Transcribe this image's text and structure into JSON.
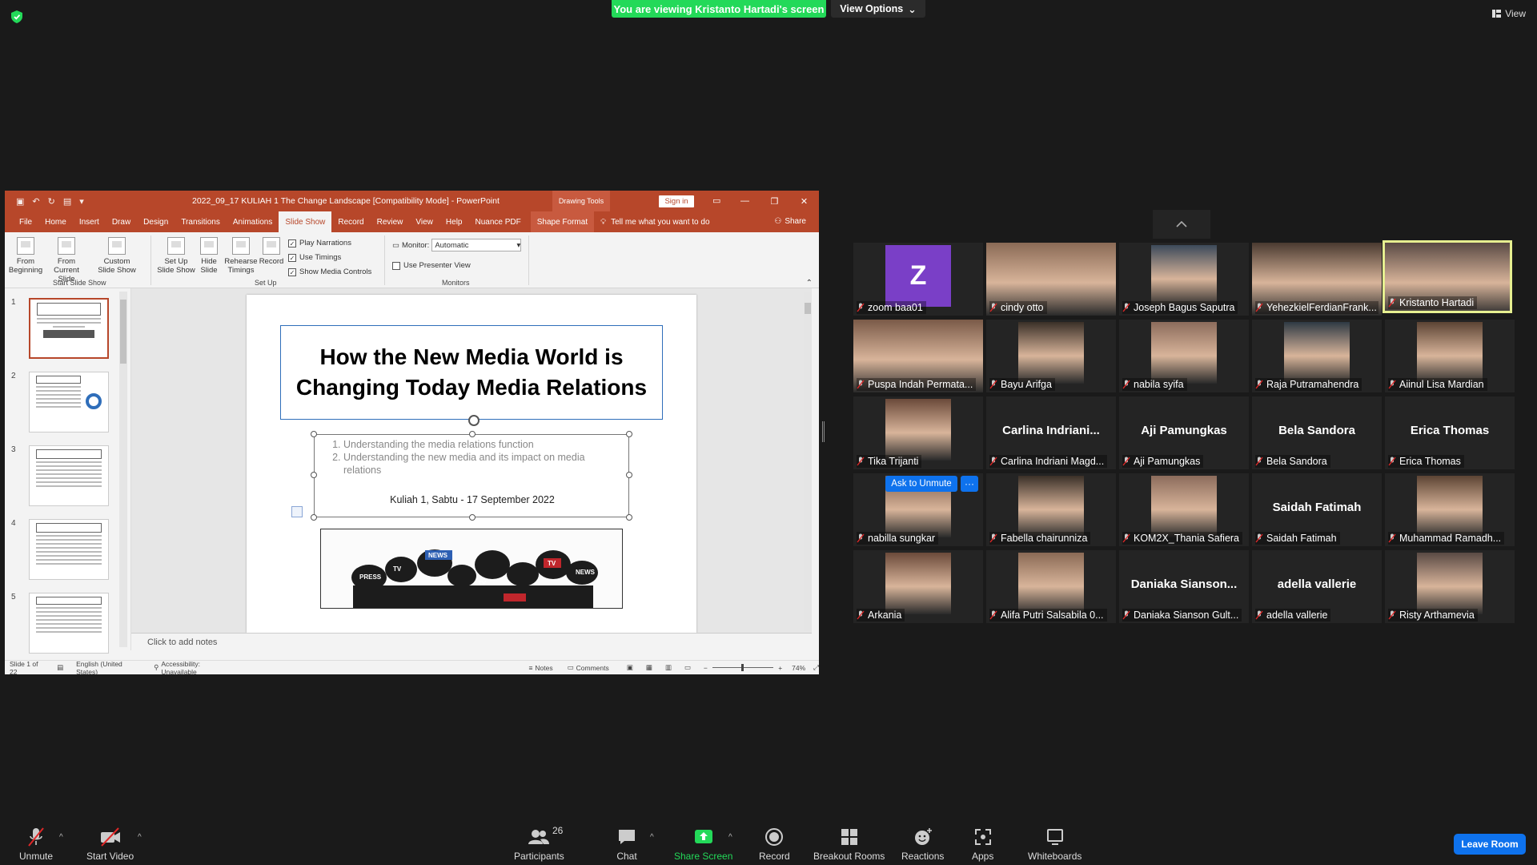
{
  "zoom": {
    "banner_text": "You are viewing Kristanto Hartadi's screen",
    "view_options_label": "View Options",
    "view_label": "View",
    "ask_to_unmute": "Ask to Unmute",
    "more_label": "···",
    "leave_label": "Leave Room",
    "toolbar": {
      "unmute": "Unmute",
      "start_video": "Start Video",
      "participants": "Participants",
      "participants_count": "26",
      "chat": "Chat",
      "share_screen": "Share Screen",
      "record": "Record",
      "breakout_rooms": "Breakout Rooms",
      "reactions": "Reactions",
      "apps": "Apps",
      "whiteboards": "Whiteboards"
    },
    "colors": {
      "green": "#23d959",
      "blue": "#0e72ed",
      "active_border": "#e6ef90"
    }
  },
  "participants": [
    {
      "name": "zoom baa01",
      "avatar": "Z"
    },
    {
      "name": "cindy otto"
    },
    {
      "name": "Joseph Bagus Saputra"
    },
    {
      "name": "YehezkielFerdianFrank..."
    },
    {
      "name": "Kristanto Hartadi"
    },
    {
      "name": "Puspa Indah Permata..."
    },
    {
      "name": "Bayu Arifga"
    },
    {
      "name": "nabila syifa"
    },
    {
      "name": "Raja Putramahendra"
    },
    {
      "name": "Aiinul Lisa Mardian"
    },
    {
      "name": "Tika Trijanti"
    },
    {
      "name": "Carlina Indriani Magd...",
      "big": "Carlina  Indriani..."
    },
    {
      "name": "Aji Pamungkas",
      "big": "Aji Pamungkas"
    },
    {
      "name": "Bela Sandora",
      "big": "Bela Sandora"
    },
    {
      "name": "Erica Thomas",
      "big": "Erica Thomas"
    },
    {
      "name": "nabilla sungkar"
    },
    {
      "name": "Fabella chairunniza"
    },
    {
      "name": "KOM2X_Thania Safiera"
    },
    {
      "name": "Saidah Fatimah",
      "big": "Saidah Fatimah"
    },
    {
      "name": "Muhammad Ramadh..."
    },
    {
      "name": "Arkania"
    },
    {
      "name": "Alifa Putri Salsabila 0..."
    },
    {
      "name": "Daniaka Sianson Gult...",
      "big": "Daniaka  Sianson..."
    },
    {
      "name": "adella vallerie",
      "big": "adella vallerie"
    },
    {
      "name": "Risty Arthamevia"
    }
  ],
  "ppt": {
    "title": "2022_09_17 KULIAH 1 The Change Landscape [Compatibility Mode]  -  PowerPoint",
    "drawing_tools": "Drawing Tools",
    "sign_in": "Sign in",
    "tabs": [
      "File",
      "Home",
      "Insert",
      "Draw",
      "Design",
      "Transitions",
      "Animations",
      "Slide Show",
      "Record",
      "Review",
      "View",
      "Help",
      "Nuance PDF"
    ],
    "shape_format": "Shape Format",
    "tell_me": "Tell me what you want to do",
    "share": "Share",
    "ribbon": {
      "from_beginning": "From Beginning",
      "from_current": "From Current Slide",
      "custom_show": "Custom Slide Show",
      "group_start": "Start Slide Show",
      "set_up_show": "Set Up Slide Show",
      "hide_slide": "Hide Slide",
      "rehearse": "Rehearse Timings",
      "record": "Record",
      "play_narrations": "Play Narrations",
      "use_timings": "Use Timings",
      "show_media": "Show Media Controls",
      "group_setup": "Set Up",
      "monitor_label": "Monitor:",
      "monitor_value": "Automatic",
      "presenter_view": "Use Presenter View",
      "group_monitors": "Monitors"
    },
    "thumbnails": [
      {
        "num": "1",
        "title": "How the New Media World is changing Today Media Relations"
      },
      {
        "num": "2",
        "title": "What is media relations?"
      },
      {
        "num": "3",
        "title": "What is your role as a media relations person?"
      },
      {
        "num": "4",
        "title": "How to Become a Media Relations Professional?"
      },
      {
        "num": "5",
        "title": "2 Programs:"
      }
    ],
    "slide": {
      "title_line1": "How the New Media World is",
      "title_line2": "Changing Today Media Relations",
      "bullet1": "Understanding the media relations function",
      "bullet2": "Understanding the new media and its impact on media relations",
      "kuliah": "Kuliah 1, Sabtu - 17 September 2022"
    },
    "notes_placeholder": "Click to add notes",
    "status": {
      "slide": "Slide 1 of 22",
      "language": "English (United States)",
      "accessibility": "Accessibility: Unavailable",
      "notes": "Notes",
      "comments": "Comments",
      "zoom": "74%"
    }
  }
}
